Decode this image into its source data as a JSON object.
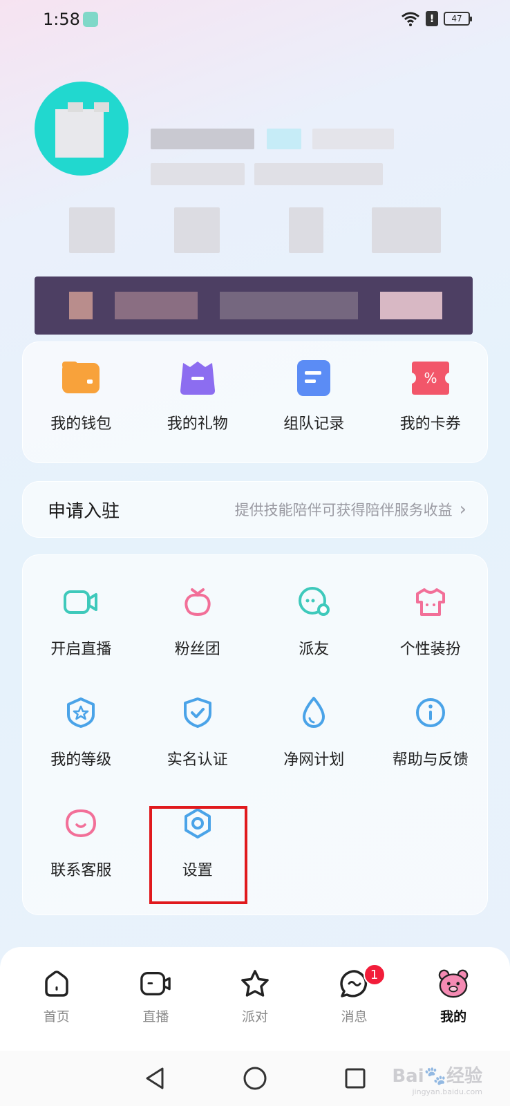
{
  "status_bar": {
    "time": "1:58",
    "battery": "47"
  },
  "quick_actions": [
    {
      "label": "我的钱包",
      "icon": "wallet-icon",
      "color": "#f8a23b"
    },
    {
      "label": "我的礼物",
      "icon": "gift-icon",
      "color": "#8c6df0"
    },
    {
      "label": "组队记录",
      "icon": "record-icon",
      "color": "#5b8cf5"
    },
    {
      "label": "我的卡券",
      "icon": "coupon-icon",
      "color": "#f2566a"
    }
  ],
  "apply": {
    "title": "申请入驻",
    "subtitle": "提供技能陪伴可获得陪伴服务收益"
  },
  "services": [
    {
      "label": "开启直播",
      "icon": "video-camera-icon"
    },
    {
      "label": "粉丝团",
      "icon": "strawberry-icon"
    },
    {
      "label": "派友",
      "icon": "chat-bubble-icon"
    },
    {
      "label": "个性装扮",
      "icon": "tshirt-icon"
    },
    {
      "label": "我的等级",
      "icon": "star-badge-icon"
    },
    {
      "label": "实名认证",
      "icon": "shield-check-icon"
    },
    {
      "label": "净网计划",
      "icon": "droplet-icon"
    },
    {
      "label": "帮助与反馈",
      "icon": "info-icon"
    },
    {
      "label": "联系客服",
      "icon": "smile-icon"
    },
    {
      "label": "设置",
      "icon": "settings-hexagon-icon"
    }
  ],
  "tabs": [
    {
      "label": "首页",
      "icon": "home-icon"
    },
    {
      "label": "直播",
      "icon": "camera-icon"
    },
    {
      "label": "派对",
      "icon": "star-icon"
    },
    {
      "label": "消息",
      "icon": "message-icon",
      "badge": "1"
    },
    {
      "label": "我的",
      "icon": "bear-face-icon",
      "active": true
    }
  ],
  "colors": {
    "teal": "#3ec9bb",
    "pink": "#f26f98",
    "blue": "#4aa3e8",
    "badge": "#f21d3a",
    "highlight": "#e0191d"
  },
  "watermark": {
    "brand": "Bai",
    "brand_cn": "经验",
    "url": "jingyan.baidu.com"
  }
}
